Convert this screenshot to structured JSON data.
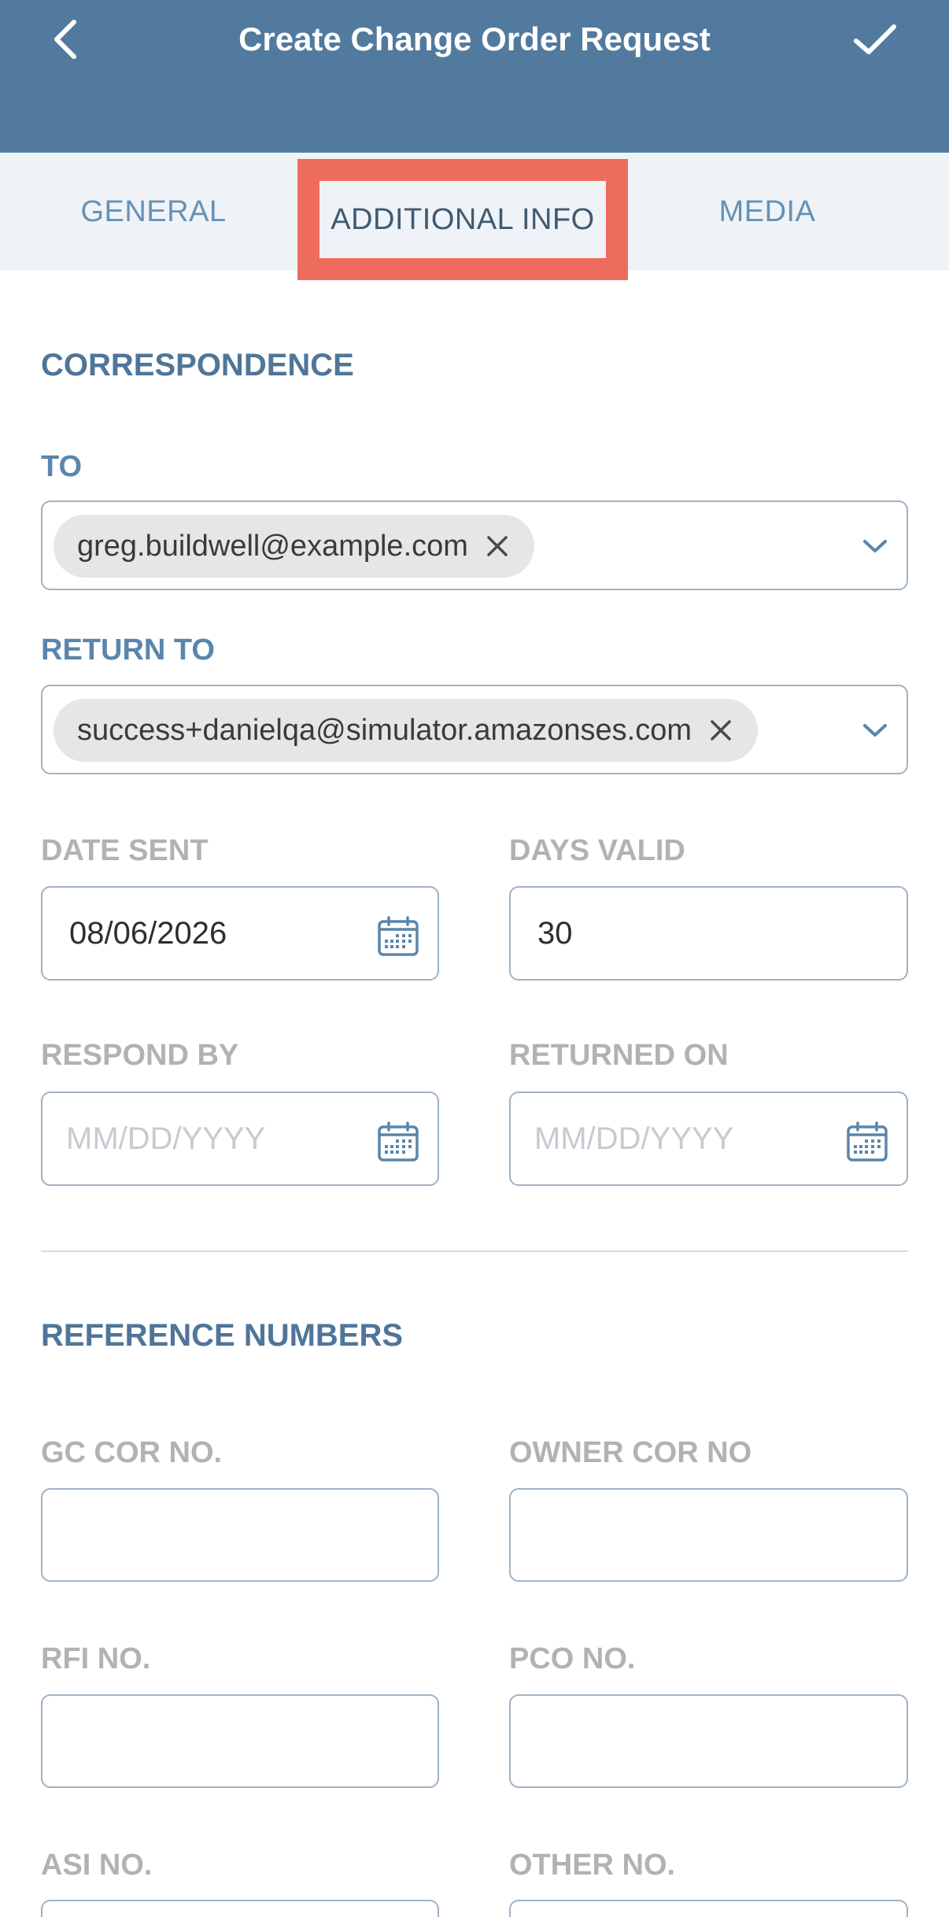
{
  "header": {
    "title": "Create Change Order Request"
  },
  "tabs": [
    {
      "label": "GENERAL"
    },
    {
      "label": "ADDITIONAL INFO"
    },
    {
      "label": "MEDIA"
    }
  ],
  "correspondence": {
    "title": "CORRESPONDENCE",
    "to_label": "TO",
    "to_chip": "greg.buildwell@example.com",
    "return_label": "RETURN TO",
    "return_chip": "success+danielqa@simulator.amazonses.com",
    "date_sent_label": "DATE SENT",
    "date_sent_value": "08/06/2026",
    "days_valid_label": "DAYS VALID",
    "days_valid_value": "30",
    "respond_by_label": "RESPOND BY",
    "respond_by_placeholder": "MM/DD/YYYY",
    "returned_on_label": "RETURNED ON",
    "returned_on_placeholder": "MM/DD/YYYY"
  },
  "reference": {
    "title": "REFERENCE NUMBERS",
    "gc_cor_label": "GC COR NO.",
    "owner_cor_label": "OWNER COR NO",
    "rfi_label": "RFI NO.",
    "pco_label": "PCO NO.",
    "asi_label": "ASI NO.",
    "other_label": "OTHER NO."
  },
  "icons": {
    "back": "chevron-left-icon",
    "confirm": "checkmark-icon",
    "remove": "close-icon",
    "dropdown": "chevron-down-icon",
    "calendar": "calendar-icon"
  },
  "colors": {
    "header_bg": "#527a9e",
    "tab_bar_bg": "#eff3f7",
    "highlight": "#ee6c5d",
    "accent": "#5a85ac"
  }
}
